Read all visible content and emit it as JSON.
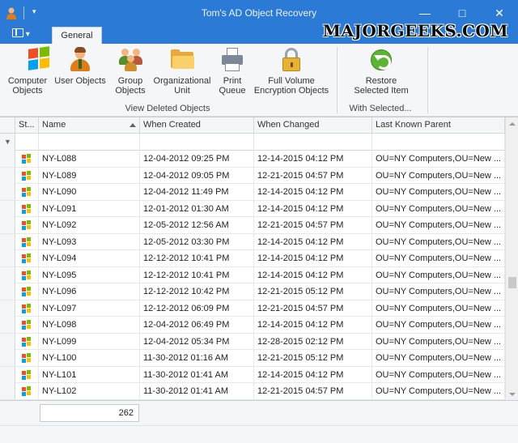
{
  "window": {
    "title": "Tom's AD Object Recovery",
    "qat_glyph": "▾",
    "minimize_glyph": "—",
    "maximize_glyph": "□",
    "close_glyph": "✕",
    "accent": "#2b7bd6"
  },
  "watermark": "MAJORGEEKS.COM",
  "ribbon": {
    "tabs": [
      {
        "label": "General"
      }
    ],
    "menu_glyph": "▾",
    "buttons": [
      {
        "label": "Computer\nObjects",
        "icon": "windows-logo-icon"
      },
      {
        "label": "User Objects",
        "icon": "user-icon"
      },
      {
        "label": "Group\nObjects",
        "icon": "group-icon"
      },
      {
        "label": "Organizational\nUnit",
        "icon": "folder-icon"
      },
      {
        "label": "Print\nQueue",
        "icon": "printer-icon"
      },
      {
        "label": "Full Volume\nEncryption Objects",
        "icon": "lock-icon"
      },
      {
        "label": "Restore\nSelected Item",
        "icon": "restore-icon"
      }
    ],
    "groups": [
      {
        "label": "View Deleted Objects"
      },
      {
        "label": "With Selected..."
      }
    ]
  },
  "grid": {
    "columns": [
      "St...",
      "Name",
      "When Created",
      "When Changed",
      "Last Known Parent"
    ],
    "filter_glyph": "▼",
    "rows": [
      {
        "name": "NY-L088",
        "created": "12-04-2012 09:25 PM",
        "changed": "12-14-2015 04:12 PM",
        "parent": "OU=NY Computers,OU=New ..."
      },
      {
        "name": "NY-L089",
        "created": "12-04-2012 09:05 PM",
        "changed": "12-21-2015 04:57 PM",
        "parent": "OU=NY Computers,OU=New ..."
      },
      {
        "name": "NY-L090",
        "created": "12-04-2012 11:49 PM",
        "changed": "12-14-2015 04:12 PM",
        "parent": "OU=NY Computers,OU=New ..."
      },
      {
        "name": "NY-L091",
        "created": "12-01-2012 01:30 AM",
        "changed": "12-14-2015 04:12 PM",
        "parent": "OU=NY Computers,OU=New ..."
      },
      {
        "name": "NY-L092",
        "created": "12-05-2012 12:56 AM",
        "changed": "12-21-2015 04:57 PM",
        "parent": "OU=NY Computers,OU=New ..."
      },
      {
        "name": "NY-L093",
        "created": "12-05-2012 03:30 PM",
        "changed": "12-14-2015 04:12 PM",
        "parent": "OU=NY Computers,OU=New ..."
      },
      {
        "name": "NY-L094",
        "created": "12-12-2012 10:41 PM",
        "changed": "12-14-2015 04:12 PM",
        "parent": "OU=NY Computers,OU=New ..."
      },
      {
        "name": "NY-L095",
        "created": "12-12-2012 10:41 PM",
        "changed": "12-14-2015 04:12 PM",
        "parent": "OU=NY Computers,OU=New ..."
      },
      {
        "name": "NY-L096",
        "created": "12-12-2012 10:42 PM",
        "changed": "12-21-2015 05:12 PM",
        "parent": "OU=NY Computers,OU=New ..."
      },
      {
        "name": "NY-L097",
        "created": "12-12-2012 06:09 PM",
        "changed": "12-21-2015 04:57 PM",
        "parent": "OU=NY Computers,OU=New ..."
      },
      {
        "name": "NY-L098",
        "created": "12-04-2012 06:49 PM",
        "changed": "12-14-2015 04:12 PM",
        "parent": "OU=NY Computers,OU=New ..."
      },
      {
        "name": "NY-L099",
        "created": "12-04-2012 05:34 PM",
        "changed": "12-28-2015 02:12 PM",
        "parent": "OU=NY Computers,OU=New ..."
      },
      {
        "name": "NY-L100",
        "created": "11-30-2012 01:16 AM",
        "changed": "12-21-2015 05:12 PM",
        "parent": "OU=NY Computers,OU=New ..."
      },
      {
        "name": "NY-L101",
        "created": "11-30-2012 01:41 AM",
        "changed": "12-14-2015 04:12 PM",
        "parent": "OU=NY Computers,OU=New ..."
      },
      {
        "name": "NY-L102",
        "created": "11-30-2012 01:41 AM",
        "changed": "12-21-2015 04:57 PM",
        "parent": "OU=NY Computers,OU=New ..."
      }
    ]
  },
  "footer": {
    "count": "262"
  }
}
